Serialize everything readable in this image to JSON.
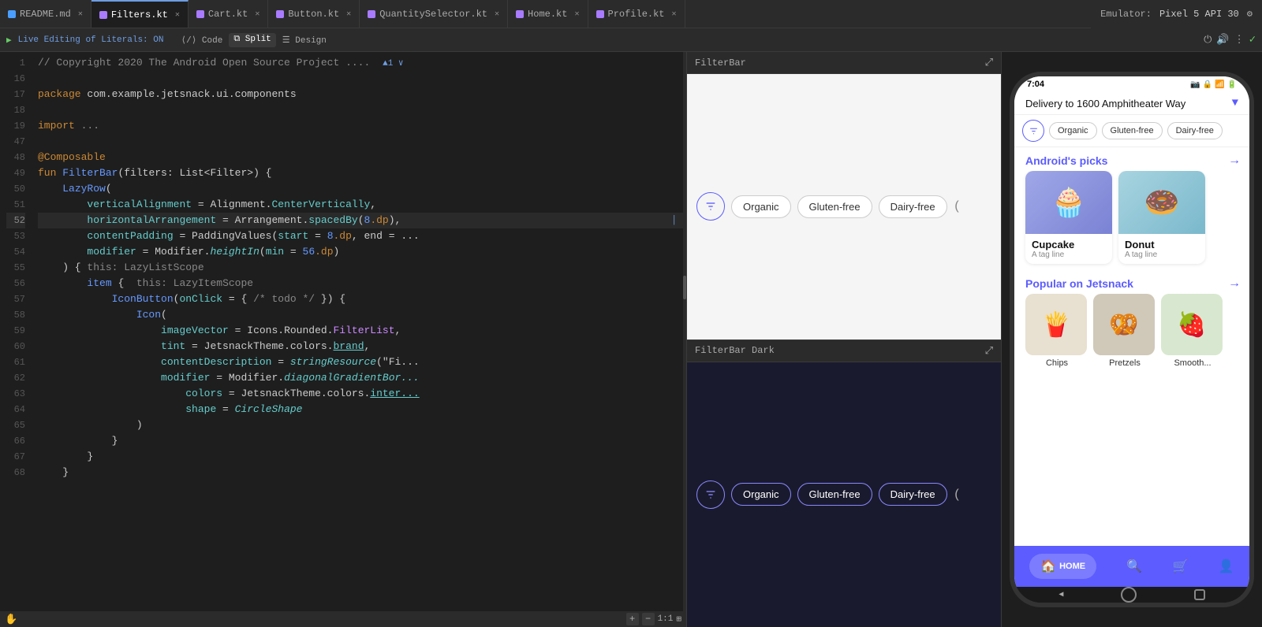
{
  "tabs": [
    {
      "label": "README.md",
      "type": "md",
      "active": false
    },
    {
      "label": "Filters.kt",
      "type": "kt",
      "active": true
    },
    {
      "label": "Cart.kt",
      "type": "kt",
      "active": false
    },
    {
      "label": "Button.kt",
      "type": "kt",
      "active": false
    },
    {
      "label": "QuantitySelector.kt",
      "type": "kt",
      "active": false
    },
    {
      "label": "Home.kt",
      "type": "kt",
      "active": false
    },
    {
      "label": "Profile.kt",
      "type": "kt",
      "active": false
    }
  ],
  "emulator": {
    "label": "Emulator:",
    "device": "Pixel 5 API 30"
  },
  "live_editing": {
    "label": "Live Editing of Literals: ON",
    "modes": [
      "Code",
      "Split",
      "Design"
    ]
  },
  "code": {
    "lines": [
      {
        "num": "1",
        "content": "// Copyright 2020 The Android Open Source Project ...."
      },
      {
        "num": "16",
        "content": ""
      },
      {
        "num": "17",
        "content": "package com.example.jetsnack.ui.components"
      },
      {
        "num": "18",
        "content": ""
      },
      {
        "num": "19",
        "content": "import ..."
      },
      {
        "num": "47",
        "content": ""
      },
      {
        "num": "48",
        "content": "@Composable"
      },
      {
        "num": "49",
        "content": "fun FilterBar(filters: List<Filter>) {"
      },
      {
        "num": "50",
        "content": "    LazyRow("
      },
      {
        "num": "51",
        "content": "        verticalAlignment = Alignment.CenterVertically,"
      },
      {
        "num": "52",
        "content": "        horizontalArrangement = Arrangement.spacedBy(8.dp),"
      },
      {
        "num": "53",
        "content": "        contentPadding = PaddingValues(start = 8.dp, end = ..."
      },
      {
        "num": "54",
        "content": "        modifier = Modifier.heightIn(min = 56.dp)"
      },
      {
        "num": "55",
        "content": "    ) { this: LazyListScope"
      },
      {
        "num": "56",
        "content": "        item {  this: LazyItemScope"
      },
      {
        "num": "57",
        "content": "            IconButton(onClick = { /* todo */ }) {"
      },
      {
        "num": "58",
        "content": "                Icon("
      },
      {
        "num": "59",
        "content": "                    imageVector = Icons.Rounded.FilterList,"
      },
      {
        "num": "60",
        "content": "                    tint = JetsnackTheme.colors.brand,"
      },
      {
        "num": "61",
        "content": "                    contentDescription = stringResource(\"Fi..."
      },
      {
        "num": "62",
        "content": "                    modifier = Modifier.diagonalGradientBor..."
      },
      {
        "num": "63",
        "content": "                        colors = JetsnackTheme.colors.inter..."
      },
      {
        "num": "64",
        "content": "                        shape = CircleShape"
      },
      {
        "num": "65",
        "content": "                )"
      },
      {
        "num": "66",
        "content": "            }"
      },
      {
        "num": "67",
        "content": "        }"
      },
      {
        "num": "68",
        "content": "    }"
      }
    ]
  },
  "preview_panels": [
    {
      "title": "FilterBar",
      "chips": [
        "Organic",
        "Gluten-free",
        "Dairy-free"
      ],
      "dark": false
    },
    {
      "title": "FilterBar Dark",
      "chips": [
        "Organic",
        "Gluten-free",
        "Dairy-free"
      ],
      "dark": true
    }
  ],
  "phone": {
    "time": "7:04",
    "delivery_text": "Delivery to 1600 Amphitheater Way",
    "filters": [
      "Organic",
      "Gluten-free",
      "Dairy-free"
    ],
    "sections": [
      {
        "title": "Android's picks",
        "items": [
          {
            "name": "Cupcake",
            "tag": "A tag line",
            "emoji": "🧁",
            "bg": "cupcake"
          },
          {
            "name": "Donut",
            "tag": "A tag line",
            "emoji": "🍩",
            "bg": "donut"
          }
        ]
      },
      {
        "title": "Popular on Jetsnack",
        "items": [
          {
            "name": "Chips",
            "emoji": "🍟",
            "bg": "chips"
          },
          {
            "name": "Pretzels",
            "emoji": "🥨",
            "bg": "pretzels"
          },
          {
            "name": "Smooth",
            "emoji": "🍓",
            "bg": "smoothie"
          }
        ]
      }
    ],
    "nav": [
      {
        "label": "HOME",
        "icon": "🏠",
        "active": true
      },
      {
        "label": "",
        "icon": "🔍",
        "active": false
      },
      {
        "label": "",
        "icon": "🛒",
        "active": false
      },
      {
        "label": "",
        "icon": "👤",
        "active": false
      }
    ]
  }
}
